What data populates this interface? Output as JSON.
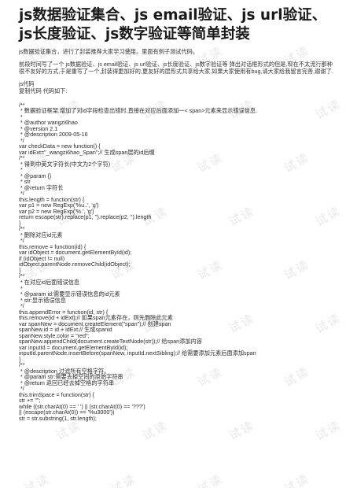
{
  "title": "js数据验证集合、js email验证、js url验证、js长度验证、js数字验证等简单封装",
  "intro": "js数据验证集合，进行了封装推荐大家学习使用。里面有例子测试代码。",
  "paragraph": "前段时间写了一个 js数据验证、js email验证、js url验证、js长度验证、js数字验证等 弹出对话框形式的但是,现在不太流行那种很不友好的方式,于是重写了一个,封装得更加好的,更友好的层形式共享给大家.如果大家使用有bug,请大家给我留言完善,谢谢了.",
  "js_label": "js代码",
  "copy_label": "复制代码 代码如下:",
  "watermark": "试读",
  "code_lines": [
    "/**",
    " * 数据验证框架.增加了对id字段检查出错时,直接在对应后面添加一< span>元素来显示错误信息.",
    " *",
    " * @author wangzi6hao",
    " * @version 2.1",
    " * @description 2009-05-16",
    " */",
    "var checkData = new function() {",
    "var idExt=\"_wangzi6hao_Span\";// 生成span层的id后缀",
    "/**",
    " * 得到中英文字符长(中文为2个字符)",
    " *",
    " * @param {}",
    " * str",
    " * @return 字符长",
    " */",
    "this.length = function(str) {",
    "var p1 = new RegExp('%u..', 'g')",
    "var p2 = new RegExp('%.', 'g')",
    "return escape(str).replace(p1, '').replace(p2, '').length",
    "}",
    "/**",
    " * 删除对应id元素",
    " */",
    "this.remove = function(id) {",
    "var idObject = document.getElementById(id);",
    "if (idObject != null)",
    "idObject.parentNode.removeChild(idObject);",
    "}",
    "/**",
    " * 在对应id后面错误信息",
    " *",
    " * @param id:需要显示错误信息的id元素",
    " * str:显示错误信息",
    " */",
    "this.appendError = function(id, str) {",
    "this.remove(id + idExt);// 如果span元素存在，则先删除此元素",
    "var spanNew = document.createElement(\"span\");// 创建span",
    "spanNew.id = id + idExt;// 生成spanid",
    "spanNew.style.color = \"red\";",
    "spanNew.appendChild(document.createTextNode(str));// 给span添加内容",
    "var inputId = document.getElementById(id);",
    "inputId.parentNode.insertBefore(spanNew, inputId.nextSibling);// 给需要添加元素后面添加span",
    "}",
    "/**",
    " * @description 过滤所有空格字符。",
    " * @param str:需要去掉空间的原始字符串",
    " * @return 返回已经去掉空格的字符串",
    " */",
    "this.trimSpace = function(str) {",
    "str += \"\";",
    "while ((str.charAt(0) == ' ') || (str.charAt(0) == '???')",
    "|| (escape(str.charAt(0)) == '%u3000'))",
    "str = str.substring(1, str.length);"
  ]
}
